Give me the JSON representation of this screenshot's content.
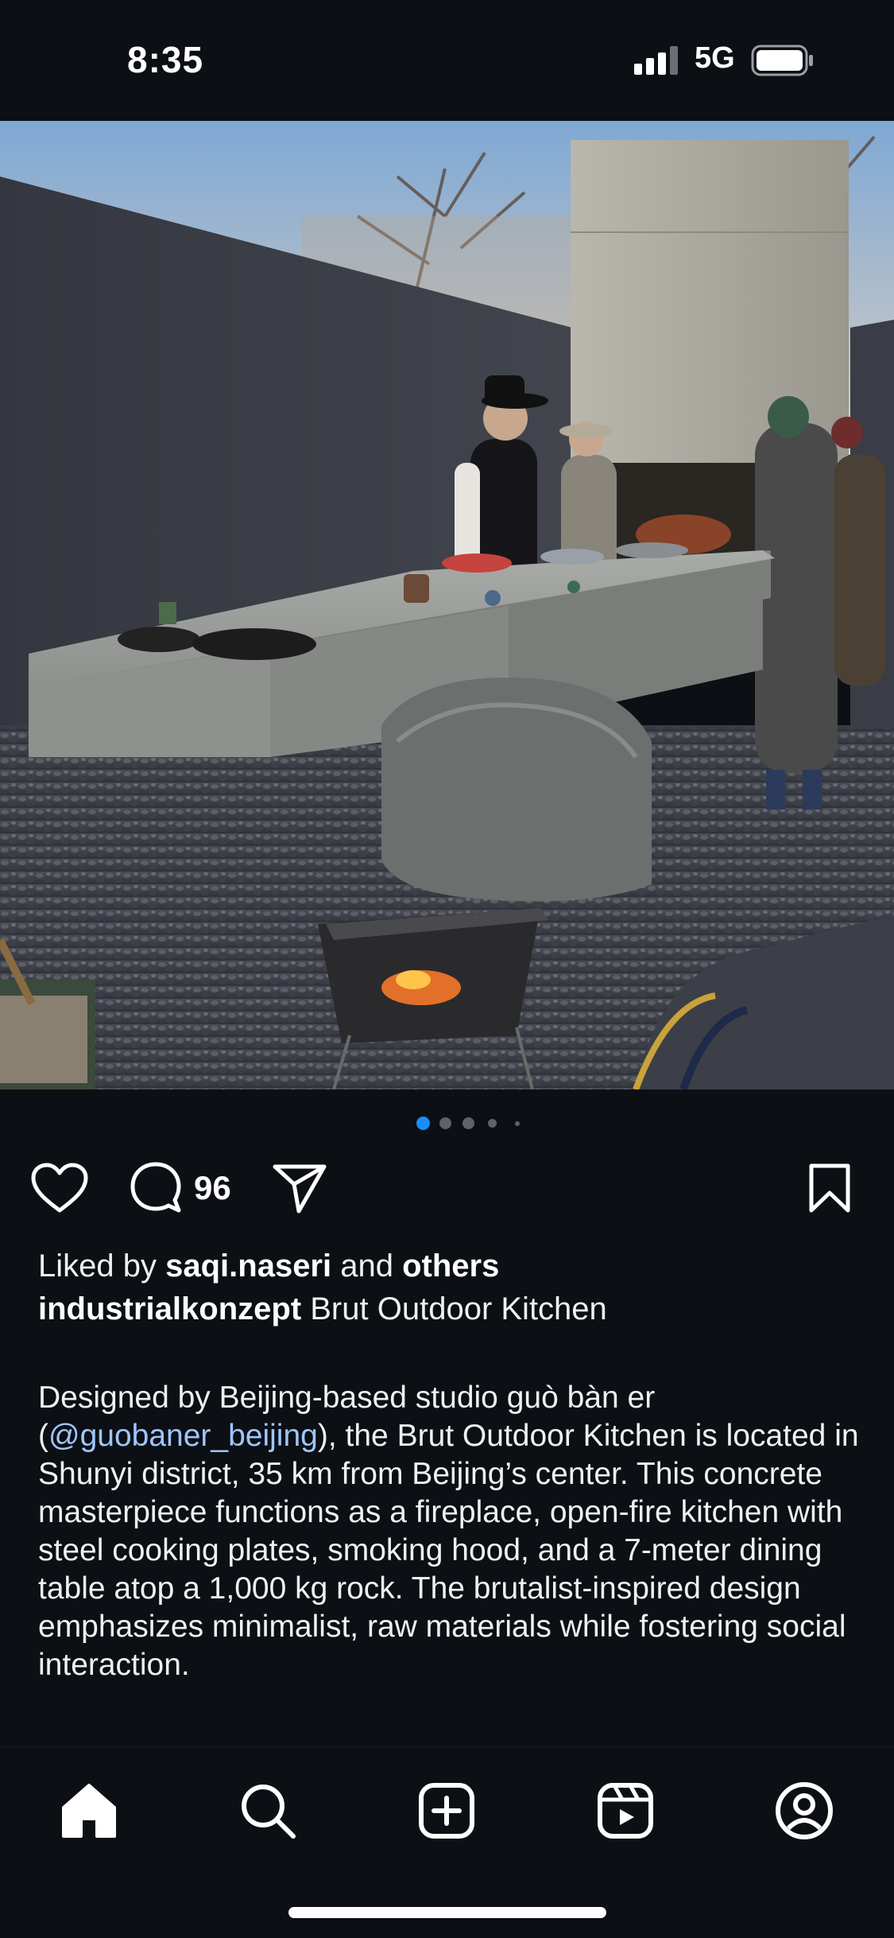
{
  "status_bar": {
    "time": "8:35",
    "network": "5G"
  },
  "carousel": {
    "count": 5,
    "active_index": 0
  },
  "actions": {
    "comment_count": "96"
  },
  "likes": {
    "prefix": "Liked by ",
    "user": "saqi.naseri",
    "middle": " and ",
    "others": "others"
  },
  "caption": {
    "username": "industrialkonzept",
    "title": " Brut Outdoor Kitchen",
    "body_start": "Designed by Beijing-based studio guò bàn er (",
    "mention": "@guobaner_beijing",
    "body_end": "), the Brut Outdoor Kitchen is located in Shunyi district, 35 km from Beijing’s center. This concrete masterpiece functions as a fireplace, open-fire kitchen with steel cooking plates, smoking hood, and a 7-meter dining table atop a 1,000 kg rock. The brutalist-inspired design emphasizes minimalist, raw materials while fostering social interaction."
  },
  "icons": {
    "like": "heart-icon",
    "comment": "comment-bubble-icon",
    "share": "paper-plane-icon",
    "save": "bookmark-icon",
    "home": "home-icon",
    "search": "search-icon",
    "create": "plus-square-icon",
    "reels": "reels-icon",
    "profile": "profile-icon"
  },
  "colors": {
    "background": "#0c0f14",
    "mention": "#9fc6ff",
    "active_dot": "#1a8cff"
  }
}
